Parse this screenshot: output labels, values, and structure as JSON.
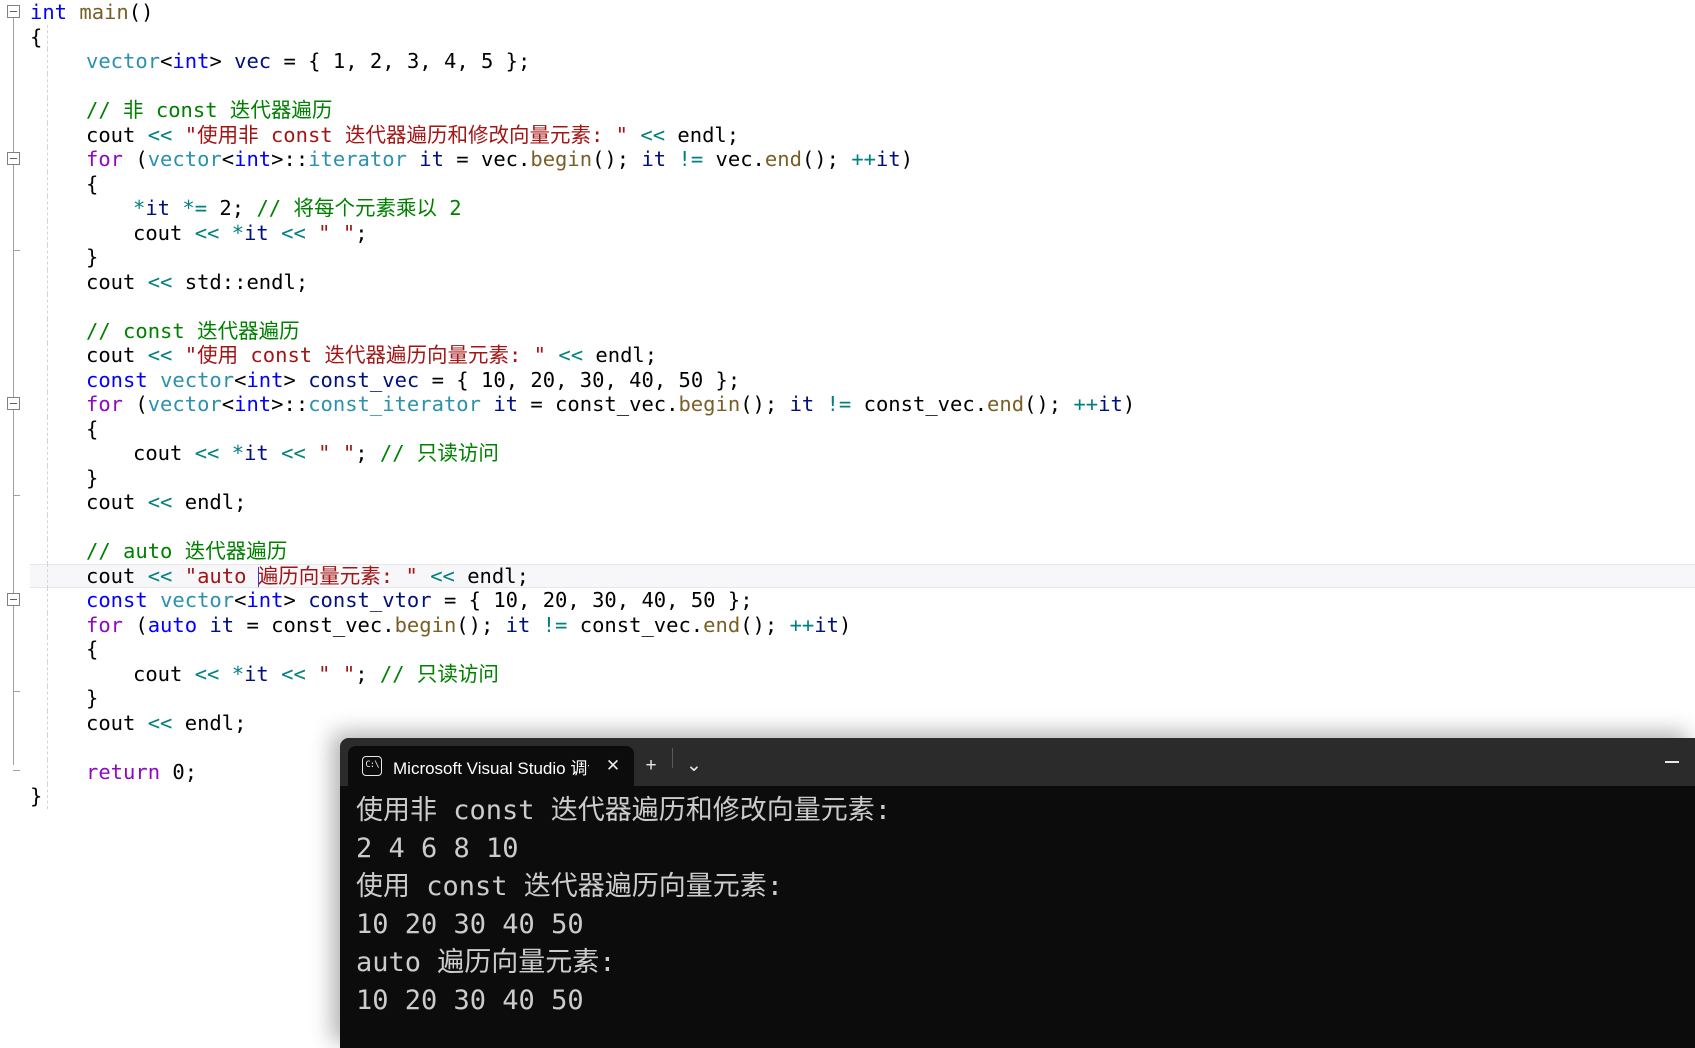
{
  "editor": {
    "name": "visual-studio-cpp-editor",
    "theme": "light",
    "colors": {
      "keyword": "#0000ff",
      "control_keyword": "#8f08c4",
      "type": "#2b91af",
      "function": "#795e26",
      "string": "#a31515",
      "comment": "#008000",
      "operator_overload": "#008080",
      "local_variable": "#001080",
      "background": "#ffffff",
      "current_line_background": "#f7f7f9"
    },
    "code_lines": [
      {
        "indent": 0,
        "fold": "open",
        "tokens": [
          {
            "t": "kw",
            "v": "int"
          },
          {
            "t": "txt",
            "v": " "
          },
          {
            "t": "fn",
            "v": "main"
          },
          {
            "t": "op",
            "v": "()"
          }
        ]
      },
      {
        "indent": 0,
        "tokens": [
          {
            "t": "op",
            "v": "{"
          }
        ]
      },
      {
        "indent": 1,
        "tokens": [
          {
            "t": "typ",
            "v": "vector"
          },
          {
            "t": "op",
            "v": "<"
          },
          {
            "t": "kw",
            "v": "int"
          },
          {
            "t": "op",
            "v": "> "
          },
          {
            "t": "loc",
            "v": "vec"
          },
          {
            "t": "op",
            "v": " = { "
          },
          {
            "t": "txt",
            "v": "1"
          },
          {
            "t": "op",
            "v": ", "
          },
          {
            "t": "txt",
            "v": "2"
          },
          {
            "t": "op",
            "v": ", "
          },
          {
            "t": "txt",
            "v": "3"
          },
          {
            "t": "op",
            "v": ", "
          },
          {
            "t": "txt",
            "v": "4"
          },
          {
            "t": "op",
            "v": ", "
          },
          {
            "t": "txt",
            "v": "5"
          },
          {
            "t": "op",
            "v": " };"
          }
        ]
      },
      {
        "indent": 1,
        "tokens": []
      },
      {
        "indent": 1,
        "tokens": [
          {
            "t": "cmt",
            "v": "// 非 const 迭代器遍历"
          }
        ]
      },
      {
        "indent": 1,
        "tokens": [
          {
            "t": "txt",
            "v": "cout "
          },
          {
            "t": "ovl",
            "v": "<<"
          },
          {
            "t": "txt",
            "v": " "
          },
          {
            "t": "str",
            "v": "\"使用非 const 迭代器遍历和修改向量元素: \""
          },
          {
            "t": "txt",
            "v": " "
          },
          {
            "t": "ovl",
            "v": "<<"
          },
          {
            "t": "txt",
            "v": " "
          },
          {
            "t": "txt",
            "v": "endl"
          },
          {
            "t": "op",
            "v": ";"
          }
        ]
      },
      {
        "indent": 1,
        "fold": "open",
        "tokens": [
          {
            "t": "ctl",
            "v": "for"
          },
          {
            "t": "op",
            "v": " ("
          },
          {
            "t": "typ",
            "v": "vector"
          },
          {
            "t": "op",
            "v": "<"
          },
          {
            "t": "kw",
            "v": "int"
          },
          {
            "t": "op",
            "v": ">::"
          },
          {
            "t": "typ",
            "v": "iterator"
          },
          {
            "t": "txt",
            "v": " "
          },
          {
            "t": "loc",
            "v": "it"
          },
          {
            "t": "op",
            "v": " = "
          },
          {
            "t": "txt",
            "v": "vec."
          },
          {
            "t": "fn",
            "v": "begin"
          },
          {
            "t": "op",
            "v": "(); "
          },
          {
            "t": "loc",
            "v": "it"
          },
          {
            "t": "txt",
            "v": " "
          },
          {
            "t": "ovl",
            "v": "!="
          },
          {
            "t": "txt",
            "v": " vec."
          },
          {
            "t": "fn",
            "v": "end"
          },
          {
            "t": "op",
            "v": "(); "
          },
          {
            "t": "ovl",
            "v": "++"
          },
          {
            "t": "loc",
            "v": "it"
          },
          {
            "t": "op",
            "v": ")"
          }
        ]
      },
      {
        "indent": 1,
        "tokens": [
          {
            "t": "op",
            "v": "{"
          }
        ]
      },
      {
        "indent": 2,
        "tokens": [
          {
            "t": "ovl",
            "v": "*"
          },
          {
            "t": "loc",
            "v": "it"
          },
          {
            "t": "txt",
            "v": " "
          },
          {
            "t": "ovl",
            "v": "*="
          },
          {
            "t": "txt",
            "v": " 2"
          },
          {
            "t": "op",
            "v": "; "
          },
          {
            "t": "cmt",
            "v": "// 将每个元素乘以 2"
          }
        ]
      },
      {
        "indent": 2,
        "tokens": [
          {
            "t": "txt",
            "v": "cout "
          },
          {
            "t": "ovl",
            "v": "<<"
          },
          {
            "t": "txt",
            "v": " "
          },
          {
            "t": "ovl",
            "v": "*"
          },
          {
            "t": "loc",
            "v": "it"
          },
          {
            "t": "txt",
            "v": " "
          },
          {
            "t": "ovl",
            "v": "<<"
          },
          {
            "t": "txt",
            "v": " "
          },
          {
            "t": "str",
            "v": "\" \""
          },
          {
            "t": "op",
            "v": ";"
          }
        ]
      },
      {
        "indent": 1,
        "tokens": [
          {
            "t": "op",
            "v": "}"
          }
        ]
      },
      {
        "indent": 1,
        "tokens": [
          {
            "t": "txt",
            "v": "cout "
          },
          {
            "t": "ovl",
            "v": "<<"
          },
          {
            "t": "txt",
            "v": " std::endl"
          },
          {
            "t": "op",
            "v": ";"
          }
        ]
      },
      {
        "indent": 1,
        "tokens": []
      },
      {
        "indent": 1,
        "tokens": [
          {
            "t": "cmt",
            "v": "// const 迭代器遍历"
          }
        ]
      },
      {
        "indent": 1,
        "tokens": [
          {
            "t": "txt",
            "v": "cout "
          },
          {
            "t": "ovl",
            "v": "<<"
          },
          {
            "t": "txt",
            "v": " "
          },
          {
            "t": "str",
            "v": "\"使用 const 迭代器遍历向量元素: \""
          },
          {
            "t": "txt",
            "v": " "
          },
          {
            "t": "ovl",
            "v": "<<"
          },
          {
            "t": "txt",
            "v": " endl"
          },
          {
            "t": "op",
            "v": ";"
          }
        ]
      },
      {
        "indent": 1,
        "tokens": [
          {
            "t": "kw",
            "v": "const"
          },
          {
            "t": "txt",
            "v": " "
          },
          {
            "t": "typ",
            "v": "vector"
          },
          {
            "t": "op",
            "v": "<"
          },
          {
            "t": "kw",
            "v": "int"
          },
          {
            "t": "op",
            "v": "> "
          },
          {
            "t": "loc",
            "v": "const_vec"
          },
          {
            "t": "op",
            "v": " = { "
          },
          {
            "t": "txt",
            "v": "10"
          },
          {
            "t": "op",
            "v": ", "
          },
          {
            "t": "txt",
            "v": "20"
          },
          {
            "t": "op",
            "v": ", "
          },
          {
            "t": "txt",
            "v": "30"
          },
          {
            "t": "op",
            "v": ", "
          },
          {
            "t": "txt",
            "v": "40"
          },
          {
            "t": "op",
            "v": ", "
          },
          {
            "t": "txt",
            "v": "50"
          },
          {
            "t": "op",
            "v": " };"
          }
        ]
      },
      {
        "indent": 1,
        "fold": "open",
        "tokens": [
          {
            "t": "ctl",
            "v": "for"
          },
          {
            "t": "op",
            "v": " ("
          },
          {
            "t": "typ",
            "v": "vector"
          },
          {
            "t": "op",
            "v": "<"
          },
          {
            "t": "kw",
            "v": "int"
          },
          {
            "t": "op",
            "v": ">::"
          },
          {
            "t": "typ",
            "v": "const_iterator"
          },
          {
            "t": "txt",
            "v": " "
          },
          {
            "t": "loc",
            "v": "it"
          },
          {
            "t": "op",
            "v": " = "
          },
          {
            "t": "txt",
            "v": "const_vec."
          },
          {
            "t": "fn",
            "v": "begin"
          },
          {
            "t": "op",
            "v": "(); "
          },
          {
            "t": "loc",
            "v": "it"
          },
          {
            "t": "txt",
            "v": " "
          },
          {
            "t": "ovl",
            "v": "!="
          },
          {
            "t": "txt",
            "v": " const_vec."
          },
          {
            "t": "fn",
            "v": "end"
          },
          {
            "t": "op",
            "v": "(); "
          },
          {
            "t": "ovl",
            "v": "++"
          },
          {
            "t": "loc",
            "v": "it"
          },
          {
            "t": "op",
            "v": ")"
          }
        ]
      },
      {
        "indent": 1,
        "tokens": [
          {
            "t": "op",
            "v": "{"
          }
        ]
      },
      {
        "indent": 2,
        "tokens": [
          {
            "t": "txt",
            "v": "cout "
          },
          {
            "t": "ovl",
            "v": "<<"
          },
          {
            "t": "txt",
            "v": " "
          },
          {
            "t": "ovl",
            "v": "*"
          },
          {
            "t": "loc",
            "v": "it"
          },
          {
            "t": "txt",
            "v": " "
          },
          {
            "t": "ovl",
            "v": "<<"
          },
          {
            "t": "txt",
            "v": " "
          },
          {
            "t": "str",
            "v": "\" \""
          },
          {
            "t": "op",
            "v": "; "
          },
          {
            "t": "cmt",
            "v": "// 只读访问"
          }
        ]
      },
      {
        "indent": 1,
        "tokens": [
          {
            "t": "op",
            "v": "}"
          }
        ]
      },
      {
        "indent": 1,
        "tokens": [
          {
            "t": "txt",
            "v": "cout "
          },
          {
            "t": "ovl",
            "v": "<<"
          },
          {
            "t": "txt",
            "v": " endl"
          },
          {
            "t": "op",
            "v": ";"
          }
        ]
      },
      {
        "indent": 1,
        "tokens": []
      },
      {
        "indent": 1,
        "tokens": [
          {
            "t": "cmt",
            "v": "// auto 迭代器遍历"
          }
        ]
      },
      {
        "indent": 1,
        "current": true,
        "caret_after": 3,
        "tokens": [
          {
            "t": "txt",
            "v": "cout "
          },
          {
            "t": "ovl",
            "v": "<<"
          },
          {
            "t": "txt",
            "v": " "
          },
          {
            "t": "str",
            "v": "\"auto "
          },
          {
            "t": "str",
            "v": "遍历向量元素: \""
          },
          {
            "t": "txt",
            "v": " "
          },
          {
            "t": "ovl",
            "v": "<<"
          },
          {
            "t": "txt",
            "v": " endl"
          },
          {
            "t": "op",
            "v": ";"
          }
        ]
      },
      {
        "indent": 1,
        "tokens": [
          {
            "t": "kw",
            "v": "const"
          },
          {
            "t": "txt",
            "v": " "
          },
          {
            "t": "typ",
            "v": "vector"
          },
          {
            "t": "op",
            "v": "<"
          },
          {
            "t": "kw",
            "v": "int"
          },
          {
            "t": "op",
            "v": "> "
          },
          {
            "t": "loc",
            "v": "const_vtor"
          },
          {
            "t": "op",
            "v": " = { "
          },
          {
            "t": "txt",
            "v": "10"
          },
          {
            "t": "op",
            "v": ", "
          },
          {
            "t": "txt",
            "v": "20"
          },
          {
            "t": "op",
            "v": ", "
          },
          {
            "t": "txt",
            "v": "30"
          },
          {
            "t": "op",
            "v": ", "
          },
          {
            "t": "txt",
            "v": "40"
          },
          {
            "t": "op",
            "v": ", "
          },
          {
            "t": "txt",
            "v": "50"
          },
          {
            "t": "op",
            "v": " };"
          }
        ]
      },
      {
        "indent": 1,
        "fold": "open",
        "tokens": [
          {
            "t": "ctl",
            "v": "for"
          },
          {
            "t": "op",
            "v": " ("
          },
          {
            "t": "kw",
            "v": "auto"
          },
          {
            "t": "txt",
            "v": " "
          },
          {
            "t": "loc",
            "v": "it"
          },
          {
            "t": "op",
            "v": " = "
          },
          {
            "t": "txt",
            "v": "const_vec."
          },
          {
            "t": "fn",
            "v": "begin"
          },
          {
            "t": "op",
            "v": "(); "
          },
          {
            "t": "loc",
            "v": "it"
          },
          {
            "t": "txt",
            "v": " "
          },
          {
            "t": "ovl",
            "v": "!="
          },
          {
            "t": "txt",
            "v": " const_vec."
          },
          {
            "t": "fn",
            "v": "end"
          },
          {
            "t": "op",
            "v": "(); "
          },
          {
            "t": "ovl",
            "v": "++"
          },
          {
            "t": "loc",
            "v": "it"
          },
          {
            "t": "op",
            "v": ")"
          }
        ]
      },
      {
        "indent": 1,
        "tokens": [
          {
            "t": "op",
            "v": "{"
          }
        ]
      },
      {
        "indent": 2,
        "tokens": [
          {
            "t": "txt",
            "v": "cout "
          },
          {
            "t": "ovl",
            "v": "<<"
          },
          {
            "t": "txt",
            "v": " "
          },
          {
            "t": "ovl",
            "v": "*"
          },
          {
            "t": "loc",
            "v": "it"
          },
          {
            "t": "txt",
            "v": " "
          },
          {
            "t": "ovl",
            "v": "<<"
          },
          {
            "t": "txt",
            "v": " "
          },
          {
            "t": "str",
            "v": "\" \""
          },
          {
            "t": "op",
            "v": "; "
          },
          {
            "t": "cmt",
            "v": "// 只读访问"
          }
        ]
      },
      {
        "indent": 1,
        "tokens": [
          {
            "t": "op",
            "v": "}"
          }
        ]
      },
      {
        "indent": 1,
        "tokens": [
          {
            "t": "txt",
            "v": "cout "
          },
          {
            "t": "ovl",
            "v": "<<"
          },
          {
            "t": "txt",
            "v": " endl"
          },
          {
            "t": "op",
            "v": ";"
          }
        ]
      },
      {
        "indent": 1,
        "tokens": []
      },
      {
        "indent": 1,
        "tokens": [
          {
            "t": "ctl",
            "v": "return"
          },
          {
            "t": "txt",
            "v": " 0"
          },
          {
            "t": "op",
            "v": ";"
          }
        ]
      },
      {
        "indent": 0,
        "tokens": [
          {
            "t": "op",
            "v": "}"
          }
        ]
      }
    ]
  },
  "console": {
    "tab": {
      "icon": "terminal-cmd-icon",
      "title": "Microsoft Visual Studio 调试控",
      "close_label": "✕"
    },
    "new_tab_label": "+",
    "dropdown_label": "⌄",
    "window_controls": {
      "minimize_label": "minimize"
    },
    "output_lines": [
      "使用非 const 迭代器遍历和修改向量元素:",
      "2 4 6 8 10",
      "使用 const 迭代器遍历向量元素:",
      "10 20 30 40 50",
      "auto 遍历向量元素:",
      "10 20 30 40 50"
    ]
  }
}
